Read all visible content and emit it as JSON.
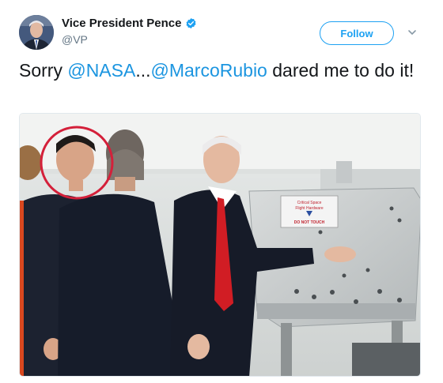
{
  "tweet": {
    "author_name": "Vice President Pence",
    "handle": "@VP",
    "verified": true,
    "follow_label": "Follow",
    "text_parts": {
      "p1": "Sorry ",
      "m1": "@NASA",
      "p2": "...",
      "m2": "@MarcoRubio",
      "p3": " dared me to do it!"
    },
    "sign_text": {
      "line1": "Critical Space",
      "line2": "Flight Hardware",
      "line3": "DO NOT TOUCH"
    }
  },
  "colors": {
    "accent": "#1da1f2",
    "mention": "#1b95e0",
    "text": "#14171a",
    "muted": "#657786",
    "highlight_circle": "#d4203a"
  },
  "icons": {
    "verified": "verified-badge-icon",
    "more": "chevron-down-icon"
  }
}
